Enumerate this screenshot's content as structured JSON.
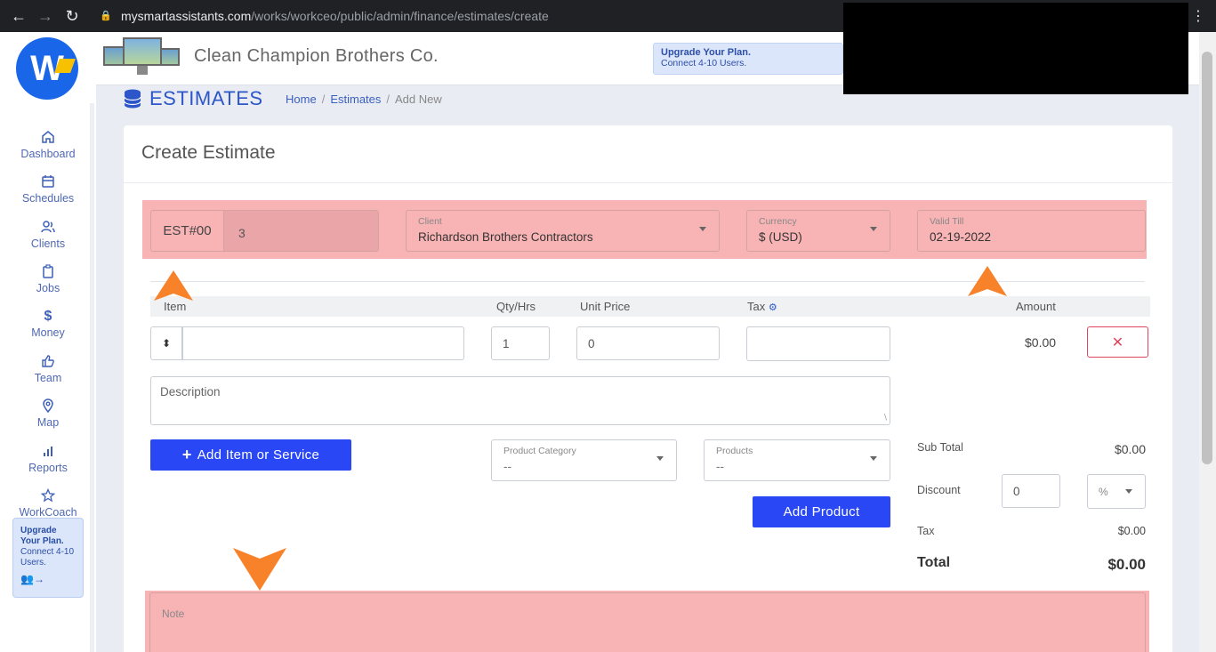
{
  "browser": {
    "url_host": "mysmartassistants.com",
    "url_path": "/works/workceo/public/admin/finance/estimates/create"
  },
  "colors": {
    "brand_blue": "#1a66e8",
    "primary_button": "#2a47f5",
    "highlight": "#f8b3b5",
    "delete_red": "#e0455c",
    "arrow_orange": "#f7822a"
  },
  "sidebar": {
    "items": [
      {
        "label": "Dashboard",
        "icon": "home-icon"
      },
      {
        "label": "Schedules",
        "icon": "calendar-icon"
      },
      {
        "label": "Clients",
        "icon": "users-icon"
      },
      {
        "label": "Jobs",
        "icon": "clipboard-icon"
      },
      {
        "label": "Money",
        "icon": "dollar-icon"
      },
      {
        "label": "Team",
        "icon": "thumbs-up-icon"
      },
      {
        "label": "Map",
        "icon": "map-pin-icon"
      },
      {
        "label": "Reports",
        "icon": "bar-chart-icon"
      },
      {
        "label": "WorkCoach",
        "icon": "star-icon"
      }
    ],
    "upgrade": {
      "title": "Upgrade Your Plan.",
      "subtitle": "Connect 4-10 Users."
    }
  },
  "header": {
    "company": "Clean Champion Brothers Co.",
    "upgrade_title": "Upgrade Your Plan.",
    "upgrade_subtitle": "Connect 4-10 Users."
  },
  "page": {
    "title": "ESTIMATES",
    "breadcrumb": [
      "Home",
      "Estimates",
      "Add New"
    ]
  },
  "form": {
    "card_title": "Create Estimate",
    "estimate_prefix": "EST#00",
    "estimate_number": "3",
    "client_label": "Client",
    "client_value": "Richardson Brothers Contractors",
    "currency_label": "Currency",
    "currency_value": "$ (USD)",
    "valid_till_label": "Valid Till",
    "valid_till_value": "02-19-2022",
    "columns": {
      "item": "Item",
      "qty": "Qty/Hrs",
      "unit_price": "Unit Price",
      "tax": "Tax",
      "amount": "Amount"
    },
    "line": {
      "item": "",
      "qty": "1",
      "unit_price": "0",
      "tax": "",
      "amount": "$0.00",
      "drag_symbol": "⬍",
      "delete_symbol": "✕"
    },
    "description_placeholder": "Description",
    "add_item_label": "Add Item or Service",
    "product_category_label": "Product Category",
    "product_category_value": "--",
    "products_label": "Products",
    "products_value": "--",
    "add_product_label": "Add Product",
    "note_placeholder": "Note"
  },
  "summary": {
    "subtotal_label": "Sub Total",
    "subtotal_value": "$0.00",
    "discount_label": "Discount",
    "discount_value": "0",
    "discount_type": "%",
    "tax_label": "Tax",
    "tax_value": "$0.00",
    "total_label": "Total",
    "total_value": "$0.00"
  }
}
